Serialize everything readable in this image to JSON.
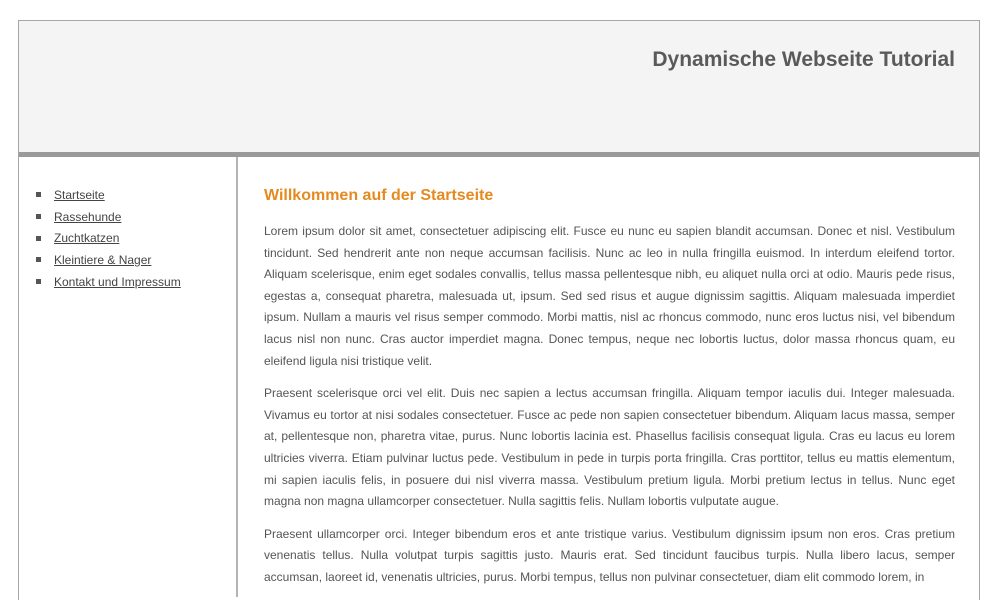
{
  "header": {
    "title": "Dynamische Webseite Tutorial"
  },
  "sidebar": {
    "items": [
      {
        "label": "Startseite"
      },
      {
        "label": "Rassehunde"
      },
      {
        "label": "Zuchtkatzen"
      },
      {
        "label": "Kleintiere & Nager"
      },
      {
        "label": "Kontakt und Impressum"
      }
    ]
  },
  "main": {
    "title": "Willkommen auf der Startseite",
    "paragraphs": [
      "Lorem ipsum dolor sit amet, consectetuer adipiscing elit. Fusce eu nunc eu sapien blandit accumsan. Donec et nisl. Vestibulum tincidunt. Sed hendrerit ante non neque accumsan facilisis. Nunc ac leo in nulla fringilla euismod. In interdum eleifend tortor. Aliquam scelerisque, enim eget sodales convallis, tellus massa pellentesque nibh, eu aliquet nulla orci at odio. Mauris pede risus, egestas a, consequat pharetra, malesuada ut, ipsum. Sed sed risus et augue dignissim sagittis. Aliquam malesuada imperdiet ipsum. Nullam a mauris vel risus semper commodo. Morbi mattis, nisl ac rhoncus commodo, nunc eros luctus nisi, vel bibendum lacus nisl non nunc. Cras auctor imperdiet magna. Donec tempus, neque nec lobortis luctus, dolor massa rhoncus quam, eu eleifend ligula nisi tristique velit.",
      "Praesent scelerisque orci vel elit. Duis nec sapien a lectus accumsan fringilla. Aliquam tempor iaculis dui. Integer malesuada. Vivamus eu tortor at nisi sodales consectetuer. Fusce ac pede non sapien consectetuer bibendum. Aliquam lacus massa, semper at, pellentesque non, pharetra vitae, purus. Nunc lobortis lacinia est. Phasellus facilisis consequat ligula. Cras eu lacus eu lorem ultricies viverra. Etiam pulvinar luctus pede. Vestibulum in pede in turpis porta fringilla. Cras porttitor, tellus eu mattis elementum, mi sapien iaculis felis, in posuere dui nisl viverra massa. Vestibulum pretium ligula. Morbi pretium lectus in tellus. Nunc eget magna non magna ullamcorper consectetuer. Nulla sagittis felis. Nullam lobortis vulputate augue.",
      "Praesent ullamcorper orci. Integer bibendum eros et ante tristique varius. Vestibulum dignissim ipsum non eros. Cras pretium venenatis tellus. Nulla volutpat turpis sagittis justo. Mauris erat. Sed tincidunt faucibus turpis. Nulla libero lacus, semper accumsan, laoreet id, venenatis ultricies, purus. Morbi tempus, tellus non pulvinar consectetuer, diam elit commodo lorem, in"
    ]
  },
  "colors": {
    "accent": "#e58a1f",
    "header_bg": "#f4f4f4",
    "header_rule": "#9a9a9a",
    "text": "#555555"
  }
}
